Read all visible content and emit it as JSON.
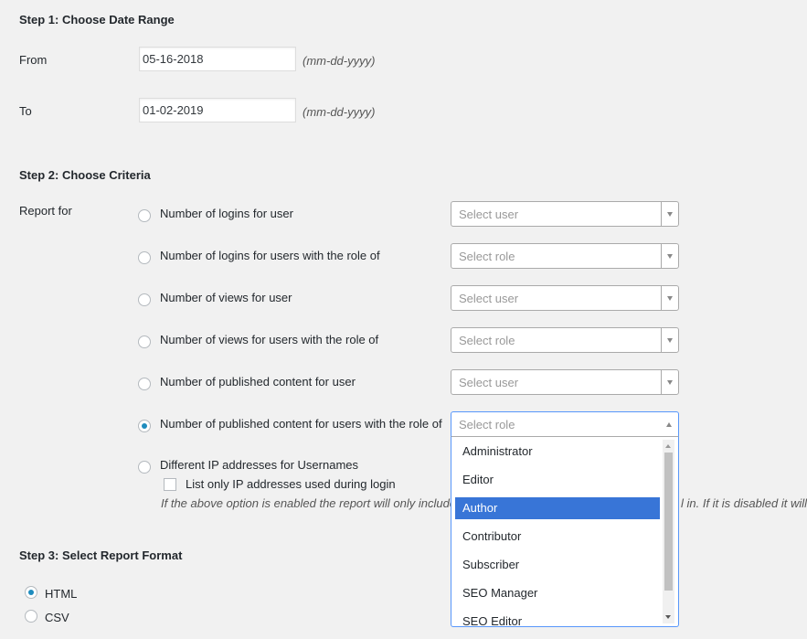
{
  "step1": {
    "title": "Step 1: Choose Date Range",
    "from_label": "From",
    "from_value": "05-16-2018",
    "to_label": "To",
    "to_value": "01-02-2019",
    "date_hint": "(mm-dd-yyyy)"
  },
  "step2": {
    "title": "Step 2: Choose Criteria",
    "report_for_label": "Report for",
    "options": [
      {
        "label": "Number of logins for user",
        "select_placeholder": "Select user",
        "checked": false
      },
      {
        "label": "Number of logins for users with the role of",
        "select_placeholder": "Select role",
        "checked": false
      },
      {
        "label": "Number of views for user",
        "select_placeholder": "Select user",
        "checked": false
      },
      {
        "label": "Number of views for users with the role of",
        "select_placeholder": "Select role",
        "checked": false
      },
      {
        "label": "Number of published content for user",
        "select_placeholder": "Select user",
        "checked": false
      },
      {
        "label": "Number of published content for users with the role of",
        "select_placeholder": "Select role",
        "checked": true
      },
      {
        "label": "Different IP addresses for Usernames",
        "checked": false
      }
    ],
    "ip_checkbox_label": "List only IP addresses used during login",
    "ip_note_left": "If the above option is enabled the report will only include",
    "ip_note_right": "l in. If it is disabled it will",
    "role_dropdown": {
      "options": [
        "Administrator",
        "Editor",
        "Author",
        "Contributor",
        "Subscriber",
        "SEO Manager",
        "SEO Editor"
      ],
      "highlighted": "Author"
    }
  },
  "step3": {
    "title": "Step 3: Select Report Format",
    "formats": [
      {
        "label": "HTML",
        "checked": true
      },
      {
        "label": "CSV",
        "checked": false
      }
    ]
  },
  "colors": {
    "accent": "#1e8cbe",
    "highlight": "#3875d7",
    "focus_border": "#5897fb"
  }
}
